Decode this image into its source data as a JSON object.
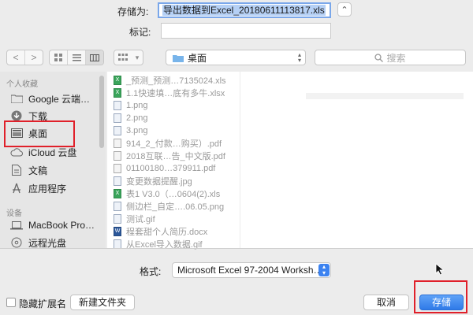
{
  "save_as": {
    "label": "存储为:",
    "value": "导出数据到Excel_20180611113817.xls",
    "expand_glyph": "⌃"
  },
  "tags": {
    "label": "标记:",
    "value": ""
  },
  "toolbar": {
    "back_glyph": "<",
    "forward_glyph": ">",
    "view_modes": [
      "icon-view",
      "list-view",
      "column-view"
    ],
    "arrange_glyph": "▾",
    "location": "桌面",
    "search_placeholder": "搜索"
  },
  "sidebar": {
    "favorites_header": "个人收藏",
    "favorites": [
      {
        "label": "Google 云端…",
        "icon": "folder-icon"
      },
      {
        "label": "下载",
        "icon": "download-icon"
      },
      {
        "label": "桌面",
        "icon": "desktop-icon",
        "selected": true
      },
      {
        "label": "iCloud 云盘",
        "icon": "cloud-icon"
      },
      {
        "label": "文稿",
        "icon": "document-icon"
      },
      {
        "label": "应用程序",
        "icon": "applications-icon"
      }
    ],
    "devices_header": "设备",
    "devices": [
      {
        "label": "MacBook Pro…",
        "icon": "laptop-icon"
      },
      {
        "label": "远程光盘",
        "icon": "disc-icon"
      }
    ]
  },
  "files": [
    {
      "name": "_预测_预测…7135024.xls",
      "type": "xls"
    },
    {
      "name": "1.1快速填…底有多牛.xlsx",
      "type": "xls"
    },
    {
      "name": "1.png",
      "type": "img"
    },
    {
      "name": "2.png",
      "type": "img"
    },
    {
      "name": "3.png",
      "type": "img"
    },
    {
      "name": "914_2_付款…购买）.pdf",
      "type": "pdf"
    },
    {
      "name": "2018互联…告_中文版.pdf",
      "type": "pdf"
    },
    {
      "name": "01100180…379911.pdf",
      "type": "pdf"
    },
    {
      "name": "变更数据提醒.jpg",
      "type": "img"
    },
    {
      "name": "表1 V3.0（…0604(2).xls",
      "type": "xls"
    },
    {
      "name": "侧边栏_自定….06.05.png",
      "type": "img"
    },
    {
      "name": "测试.gif",
      "type": "img"
    },
    {
      "name": "程套甜个人简历.docx",
      "type": "doc"
    },
    {
      "name": "从Excel导入数据.gif",
      "type": "img"
    }
  ],
  "format": {
    "label": "格式:",
    "value": "Microsoft Excel 97-2004 Worksh…"
  },
  "bottom": {
    "hide_extension_label": "隐藏扩展名",
    "new_folder_label": "新建文件夹",
    "cancel_label": "取消",
    "save_label": "存储"
  },
  "colors": {
    "accent": "#2f7ae8",
    "highlight_border": "#e0202a",
    "selection": "#b5d0f5"
  }
}
